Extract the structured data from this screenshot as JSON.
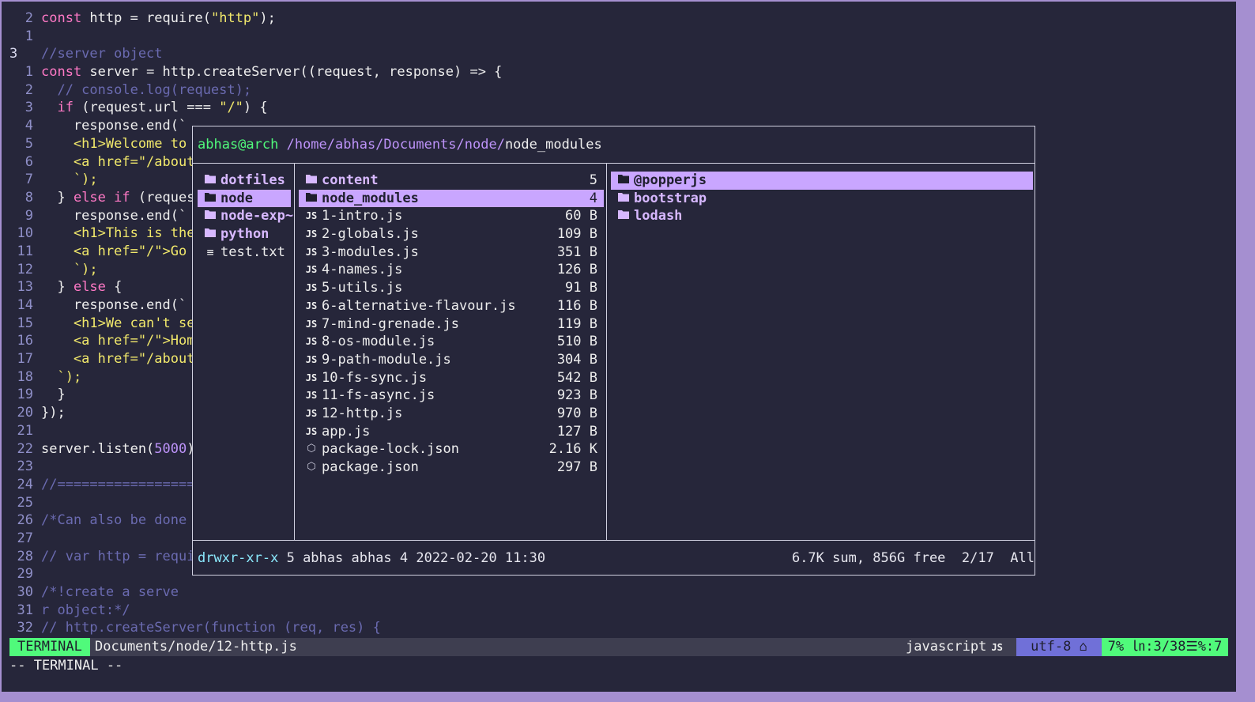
{
  "editor": {
    "lines": [
      {
        "n": "2",
        "tokens": [
          [
            "kw",
            "const"
          ],
          [
            "plain",
            " http = require("
          ],
          [
            "str",
            "\"http\""
          ],
          [
            "plain",
            ");"
          ]
        ]
      },
      {
        "n": "1",
        "tokens": []
      },
      {
        "n": "3",
        "cur": true,
        "tokens": [
          [
            "cmt",
            "//server object"
          ]
        ]
      },
      {
        "n": "1",
        "tokens": [
          [
            "kw",
            "const"
          ],
          [
            "plain",
            " server = http.createServer((request, response) => {"
          ]
        ]
      },
      {
        "n": "2",
        "tokens": [
          [
            "cmt",
            "  // console.log(request);"
          ]
        ]
      },
      {
        "n": "3",
        "tokens": [
          [
            "plain",
            "  "
          ],
          [
            "kw",
            "if"
          ],
          [
            "plain",
            " (request.url === "
          ],
          [
            "str",
            "\"/\""
          ],
          [
            "plain",
            ") {"
          ]
        ]
      },
      {
        "n": "4",
        "tokens": [
          [
            "plain",
            "    response.end(`"
          ]
        ]
      },
      {
        "n": "5",
        "tokens": [
          [
            "str",
            "    <h1>Welcome to"
          ]
        ]
      },
      {
        "n": "6",
        "tokens": [
          [
            "str",
            "    <a href=\"/about"
          ]
        ]
      },
      {
        "n": "7",
        "tokens": [
          [
            "str",
            "    `);"
          ]
        ]
      },
      {
        "n": "8",
        "tokens": [
          [
            "plain",
            "  } "
          ],
          [
            "kw",
            "else if"
          ],
          [
            "plain",
            " (reques"
          ]
        ]
      },
      {
        "n": "9",
        "tokens": [
          [
            "plain",
            "    response.end(`"
          ]
        ]
      },
      {
        "n": "10",
        "tokens": [
          [
            "str",
            "    <h1>This is the"
          ]
        ]
      },
      {
        "n": "11",
        "tokens": [
          [
            "str",
            "    <a href=\"/\">Go"
          ]
        ]
      },
      {
        "n": "12",
        "tokens": [
          [
            "str",
            "    `);"
          ]
        ]
      },
      {
        "n": "13",
        "tokens": [
          [
            "plain",
            "  } "
          ],
          [
            "kw",
            "else"
          ],
          [
            "plain",
            " {"
          ]
        ]
      },
      {
        "n": "14",
        "tokens": [
          [
            "plain",
            "    response.end(`"
          ]
        ]
      },
      {
        "n": "15",
        "tokens": [
          [
            "str",
            "    <h1>We can't se"
          ]
        ]
      },
      {
        "n": "16",
        "tokens": [
          [
            "str",
            "    <a href=\"/\">Hom"
          ]
        ]
      },
      {
        "n": "17",
        "tokens": [
          [
            "str",
            "    <a href=\"/about"
          ]
        ]
      },
      {
        "n": "18",
        "tokens": [
          [
            "str",
            "  `);"
          ]
        ]
      },
      {
        "n": "19",
        "tokens": [
          [
            "plain",
            "  }"
          ]
        ]
      },
      {
        "n": "20",
        "tokens": [
          [
            "plain",
            "});"
          ]
        ]
      },
      {
        "n": "21",
        "tokens": []
      },
      {
        "n": "22",
        "tokens": [
          [
            "plain",
            "server.listen("
          ],
          [
            "num",
            "5000"
          ],
          [
            "plain",
            ")"
          ]
        ]
      },
      {
        "n": "23",
        "tokens": []
      },
      {
        "n": "24",
        "tokens": [
          [
            "cmt",
            "//================="
          ]
        ]
      },
      {
        "n": "25",
        "tokens": []
      },
      {
        "n": "26",
        "tokens": [
          [
            "cmt",
            "/*Can also be done"
          ]
        ]
      },
      {
        "n": "27",
        "tokens": []
      },
      {
        "n": "28",
        "tokens": [
          [
            "cmt",
            "// var http = requi"
          ]
        ]
      },
      {
        "n": "29",
        "tokens": []
      },
      {
        "n": "30",
        "tokens": [
          [
            "cmt",
            "/*!create a serve"
          ]
        ]
      },
      {
        "n": "31",
        "tokens": [
          [
            "cmt",
            "r object:*/"
          ]
        ]
      },
      {
        "n": "32",
        "tokens": [
          [
            "cmt",
            "// http.createServer(function (req, res) {"
          ]
        ]
      }
    ]
  },
  "statusline": {
    "mode": "TERMINAL",
    "file": "Documents/node/12-http.js",
    "filetype": "javascript",
    "filetype_icon": "JS",
    "encoding": "utf-8 ",
    "encoding_icon": "linux-icon",
    "position": "7% ㏑:3/38☰%:7"
  },
  "cmdline": "-- TERMINAL --",
  "ranger": {
    "user_host": "abhas@arch",
    "path": " /home/abhas/Documents/node/",
    "current": "node_modules",
    "parent": [
      {
        "name": "dotfiles",
        "type": "dir"
      },
      {
        "name": "node",
        "type": "dir",
        "selected": true
      },
      {
        "name": "node-exp~",
        "type": "dir"
      },
      {
        "name": "python",
        "type": "dir"
      },
      {
        "name": "test.txt",
        "type": "txt"
      }
    ],
    "current_list": [
      {
        "name": "content",
        "type": "dir",
        "size": "5"
      },
      {
        "name": "node_modules",
        "type": "dir",
        "size": "4",
        "selected": true
      },
      {
        "name": "1-intro.js",
        "type": "js",
        "size": "60 B"
      },
      {
        "name": "2-globals.js",
        "type": "js",
        "size": "109 B"
      },
      {
        "name": "3-modules.js",
        "type": "js",
        "size": "351 B"
      },
      {
        "name": "4-names.js",
        "type": "js",
        "size": "126 B"
      },
      {
        "name": "5-utils.js",
        "type": "js",
        "size": "91 B"
      },
      {
        "name": "6-alternative-flavour.js",
        "type": "js",
        "size": "116 B"
      },
      {
        "name": "7-mind-grenade.js",
        "type": "js",
        "size": "119 B"
      },
      {
        "name": "8-os-module.js",
        "type": "js",
        "size": "510 B"
      },
      {
        "name": "9-path-module.js",
        "type": "js",
        "size": "304 B"
      },
      {
        "name": "10-fs-sync.js",
        "type": "js",
        "size": "542 B"
      },
      {
        "name": "11-fs-async.js",
        "type": "js",
        "size": "923 B"
      },
      {
        "name": "12-http.js",
        "type": "js",
        "size": "970 B"
      },
      {
        "name": "app.js",
        "type": "js",
        "size": "127 B"
      },
      {
        "name": "package-lock.json",
        "type": "pkg",
        "size": "2.16 K"
      },
      {
        "name": "package.json",
        "type": "pkg",
        "size": "297 B"
      }
    ],
    "preview": [
      {
        "name": "@popperjs",
        "type": "dir",
        "selected": true
      },
      {
        "name": "bootstrap",
        "type": "dir"
      },
      {
        "name": "lodash",
        "type": "dir"
      }
    ],
    "info_perm": "drwxr-xr-x",
    "info_rest": " 5 abhas abhas 4 2022-02-20 11:30",
    "info_right": "6.7K sum, 856G free  2/17  All"
  },
  "icons": {
    "dir": "folder-icon",
    "js": "javascript-file-icon",
    "pkg": "package-icon",
    "txt": "text-file-icon"
  }
}
